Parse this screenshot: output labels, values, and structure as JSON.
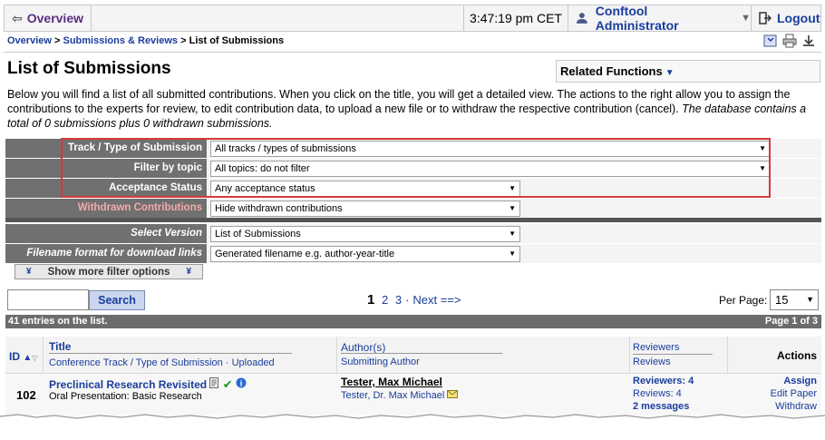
{
  "topbar": {
    "overview": "Overview",
    "time": "3:47:19 pm CET",
    "user": "Conftool Administrator",
    "logout": "Logout"
  },
  "breadcrumb": {
    "overview": "Overview",
    "submissions": "Submissions & Reviews",
    "current": "List of Submissions",
    "sep": ">"
  },
  "page": {
    "title": "List of Submissions",
    "related": "Related Functions",
    "intro": "Below you will find a list of all submitted contributions. When you click on the title, you will get a detailed view. The actions to the right allow you to assign the contributions to the experts for review, to edit contribution data, to upload a new file or to withdraw the respective contribution (cancel).",
    "intro_italic": "The database contains a total of 0 submissions plus 0 withdrawn submissions."
  },
  "filters": {
    "track_label": "Track / Type of Submission",
    "track_value": "All tracks / types of submissions",
    "topic_label": "Filter by topic",
    "topic_value": "All topics: do not filter",
    "acceptance_label": "Acceptance Status",
    "acceptance_value": "Any acceptance status",
    "withdrawn_label": "Withdrawn Contributions",
    "withdrawn_value": "Hide withdrawn contributions",
    "version_label": "Select Version",
    "version_value": "List of Submissions",
    "filename_label": "Filename format for download links",
    "filename_value": "Generated filename e.g. author-year-title",
    "show_more": "Show more filter options"
  },
  "search": {
    "button": "Search",
    "value": ""
  },
  "pager": {
    "current": "1",
    "p2": "2",
    "p3": "3",
    "sep": "·",
    "next": "Next ==>",
    "per_page_label": "Per Page:",
    "per_page": "15"
  },
  "list": {
    "entries": "41 entries on the list.",
    "page": "Page 1 of 3"
  },
  "table": {
    "col_id": "ID",
    "col_title": "Title",
    "col_title_sub1": "Conference Track / Type of Submission",
    "col_title_sub_sep": "·",
    "col_title_sub2": "Uploaded",
    "col_author": "Author(s)",
    "col_author_sub": "Submitting Author",
    "col_reviewers": "Reviewers",
    "col_reviews": "Reviews",
    "col_actions": "Actions",
    "rows": [
      {
        "id": "102",
        "title": "Preclinical Research Revisited",
        "track": "Oral Presentation: Basic Research",
        "author": "Tester, Max Michael",
        "submitter": "Tester, Dr. Max Michael",
        "reviewers": "Reviewers: 4",
        "reviews": "Reviews: 4",
        "messages": "2 messages",
        "assign": "Assign",
        "edit": "Edit Paper",
        "withdraw": "Withdraw"
      }
    ]
  },
  "colors": {
    "link": "#1a3d9c",
    "label_bg": "#707070",
    "highlight": "#d63a3a",
    "withdrawn": "#f5a9a9"
  }
}
